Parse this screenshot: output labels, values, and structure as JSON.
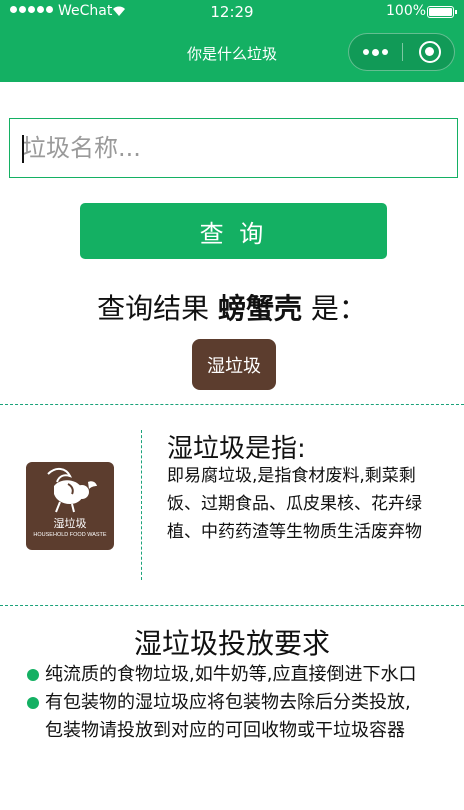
{
  "statusbar": {
    "carrier": "WeChat",
    "time": "12:29",
    "battery": "100%"
  },
  "navbar": {
    "title": "你是什么垃圾"
  },
  "search": {
    "placeholder": "垃圾名称...",
    "value": "",
    "button_label": "查 询"
  },
  "result": {
    "prefix": "查询结果 ",
    "item": "螃蟹壳",
    "suffix": " 是：",
    "category": "湿垃圾"
  },
  "definition": {
    "logo_text_cn": "湿垃圾",
    "logo_text_en": "HOUSEHOLD FOOD WASTE",
    "title": "湿垃圾是指:",
    "text": "即易腐垃圾,是指食材废料,剩菜剩饭、过期食品、瓜皮果核、花卉绿植、中药药渣等生物质生活废弃物"
  },
  "requirements": {
    "title": "湿垃圾投放要求",
    "items": [
      "纯流质的食物垃圾,如牛奶等,应直接倒进下水口",
      "有包装物的湿垃圾应将包装物去除后分类投放,包装物请投放到对应的可回收物或干垃圾容器"
    ]
  },
  "colors": {
    "brand_green": "#14b063",
    "wet_waste_brown": "#5c3d2e",
    "divider": "#1ba27a"
  },
  "icons": [
    "signal-icon",
    "wifi-icon",
    "battery-icon",
    "more-icon",
    "close-icon",
    "wet-waste-logo-icon"
  ]
}
